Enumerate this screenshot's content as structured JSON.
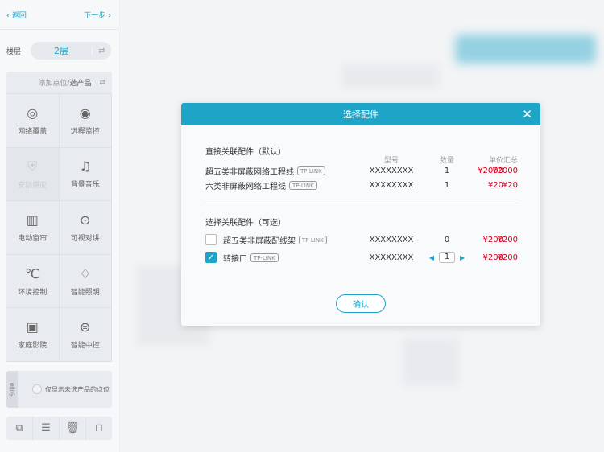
{
  "nav": {
    "back": "返回",
    "next": "下一步"
  },
  "floor": {
    "label": "楼层",
    "value": "2层"
  },
  "grid": {
    "header_a": "添加点位/",
    "header_b": "选产品",
    "items": [
      {
        "label": "网络覆盖",
        "icon": "wifi-tower-icon",
        "glyph": "◎"
      },
      {
        "label": "远程监控",
        "icon": "camera-icon",
        "glyph": "◉"
      },
      {
        "label": "安防感应",
        "icon": "shield-icon",
        "glyph": "⛨"
      },
      {
        "label": "背景音乐",
        "icon": "music-icon",
        "glyph": "♫"
      },
      {
        "label": "电动窗帘",
        "icon": "curtain-icon",
        "glyph": "▥"
      },
      {
        "label": "可视对讲",
        "icon": "intercom-icon",
        "glyph": "⊙"
      },
      {
        "label": "环境控制",
        "icon": "temperature-icon",
        "glyph": "℃"
      },
      {
        "label": "智能照明",
        "icon": "lamp-icon",
        "glyph": "♢"
      },
      {
        "label": "家庭影院",
        "icon": "video-icon",
        "glyph": "▣"
      },
      {
        "label": "智能中控",
        "icon": "control-icon",
        "glyph": "⊜"
      }
    ]
  },
  "show": {
    "tag": "显示",
    "option": "仅显示未选产品的点位"
  },
  "dialog": {
    "title": "选择配件",
    "direct_title": "直接关联配件（默认）",
    "optional_title": "选择关联配件（可选）",
    "headers": {
      "model": "型号",
      "qty": "数量",
      "price": "单价",
      "total": "汇总"
    },
    "direct": [
      {
        "name": "超五类非屏蔽网络工程线",
        "brand": "TP-LINK",
        "model": "XXXXXXXX",
        "qty": "1",
        "price": "¥2000",
        "total": "¥2000"
      },
      {
        "name": "六类非屏蔽网络工程线",
        "brand": "TP-LINK",
        "model": "XXXXXXXX",
        "qty": "1",
        "price": "¥20",
        "total": "¥20"
      }
    ],
    "optional": [
      {
        "name": "超五类非屏蔽配线架",
        "brand": "TP-LINK",
        "model": "XXXXXXXX",
        "qty": "0",
        "price": "¥200",
        "total": "¥200",
        "checked": false
      },
      {
        "name": "转接口",
        "brand": "TP-LINK",
        "model": "XXXXXXXX",
        "qty": "1",
        "price": "¥200",
        "total": "¥200",
        "checked": true
      }
    ],
    "confirm": "确认"
  }
}
